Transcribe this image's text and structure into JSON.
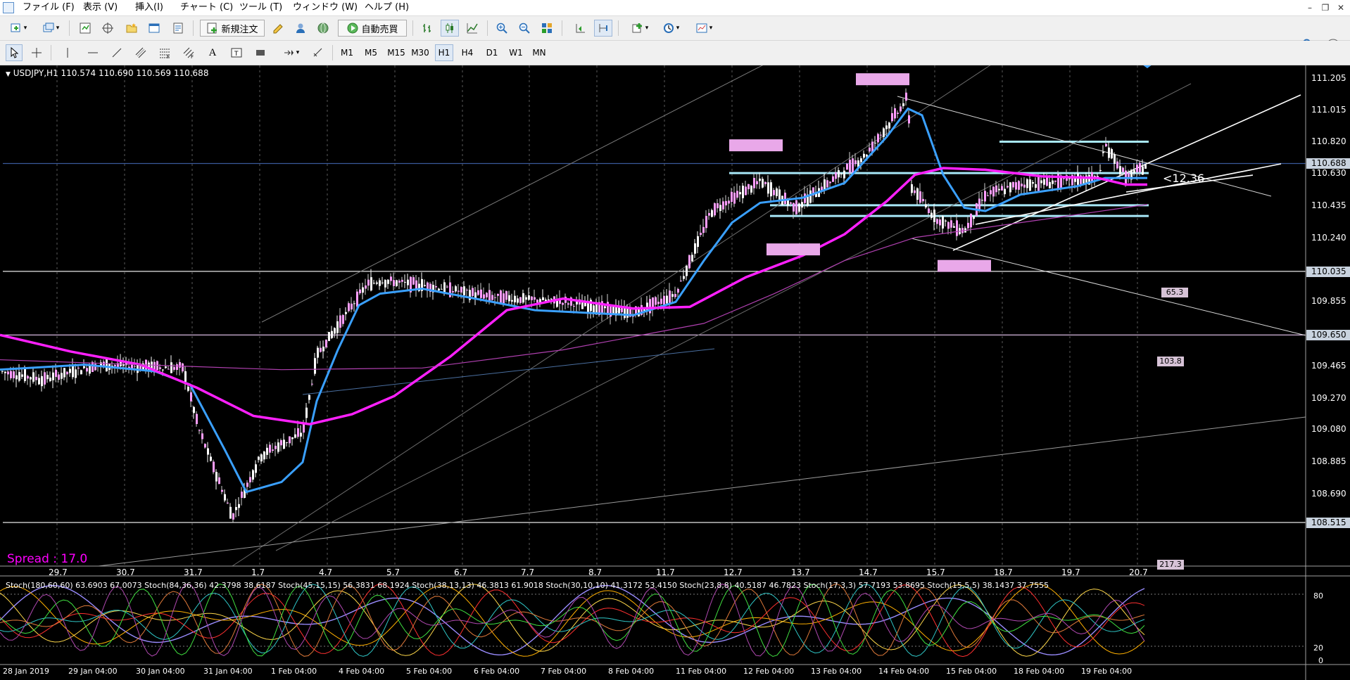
{
  "menubar": {
    "items": [
      "ファイル (F)",
      "表示 (V)",
      "挿入(I)",
      "チャート (C)",
      "ツール (T)",
      "ウィンドウ (W)",
      "ヘルプ (H)"
    ],
    "minimize": "–",
    "restore": "❐",
    "close": "✕"
  },
  "toolbar": {
    "new_order": "新規注文",
    "auto_trading": "自動売買",
    "timeframes": [
      "M1",
      "M5",
      "M15",
      "M30",
      "H1",
      "H4",
      "D1",
      "W1",
      "MN"
    ],
    "active_timeframe": "H1",
    "text_tool": "A"
  },
  "chart": {
    "symbol_line": "USDJPY,H1  110.574 110.690 110.569 110.688",
    "spread": "Spread : 17.0",
    "price_axis": [
      "111.205",
      "111.015",
      "110.820",
      "110.630",
      "110.435",
      "110.240",
      "110.035",
      "109.855",
      "109.650",
      "109.465",
      "109.270",
      "109.080",
      "108.885",
      "108.690",
      "108.515"
    ],
    "current_price": "110.688",
    "highlight_prices": [
      "110.688",
      "110.035",
      "109.650",
      "108.515"
    ],
    "annotation": "<12.36",
    "line_tags": [
      "65.3",
      "103.8",
      "217.3"
    ],
    "day_labels": [
      "29.7",
      "30.7",
      "31.7",
      "1.7",
      "4.7",
      "5.7",
      "6.7",
      "7.7",
      "8.7",
      "11.7",
      "12.7",
      "13.7",
      "14.7",
      "15.7",
      "18.7",
      "19.7",
      "20.7"
    ],
    "time_axis": [
      "28 Jan 2019",
      "29 Jan 04:00",
      "30 Jan 04:00",
      "31 Jan 04:00",
      "1 Feb 04:00",
      "4 Feb 04:00",
      "5 Feb 04:00",
      "6 Feb 04:00",
      "7 Feb 04:00",
      "8 Feb 04:00",
      "11 Feb 04:00",
      "12 Feb 04:00",
      "13 Feb 04:00",
      "14 Feb 04:00",
      "15 Feb 04:00",
      "18 Feb 04:00",
      "19 Feb 04:00"
    ],
    "stoch_caption": "Stoch(180,60,60) 63.6903 67.0073  Stoch(84,36,36) 42.3798 38.6187  Stoch(45,15,15) 56.3831 68.1924  Stoch(38,13,13) 46.3813 61.9018  Stoch(30,10,10) 41.3172 53.4150  Stoch(23,8,8) 40.5187 46.7823  Stoch(17,3,3) 57.7193 53.8695  Stoch(15,5,5) 38.1437 37.7555",
    "stoch_levels": [
      "80",
      "20",
      "0"
    ],
    "colors": {
      "ma_fast": "#3aa0ff",
      "ma_slow": "#ff20ff",
      "level_line": "#a8e8f8",
      "box": "#e9a8e9"
    }
  }
}
